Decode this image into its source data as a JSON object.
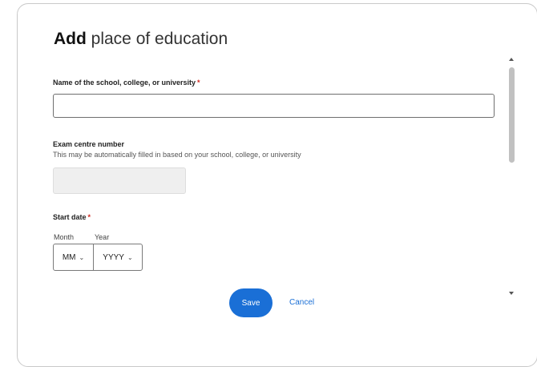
{
  "dialog": {
    "title_bold": "Add",
    "title_rest": " place of education"
  },
  "form": {
    "school": {
      "label": "Name of the school, college, or university",
      "required_mark": "*",
      "value": ""
    },
    "exam_centre": {
      "label": "Exam centre number",
      "hint": "This may be automatically filled in based on your school, college, or university",
      "value": ""
    },
    "start_date": {
      "label": "Start date",
      "required_mark": "*",
      "month_label": "Month",
      "year_label": "Year",
      "month_value": "MM",
      "year_value": "YYYY"
    }
  },
  "actions": {
    "save_label": "Save",
    "cancel_label": "Cancel"
  },
  "icons": {
    "chevron": "chevron-down-icon"
  },
  "colors": {
    "accent": "#1a6fd6",
    "required": "#d0271d",
    "disabled_fill": "#efefef"
  }
}
